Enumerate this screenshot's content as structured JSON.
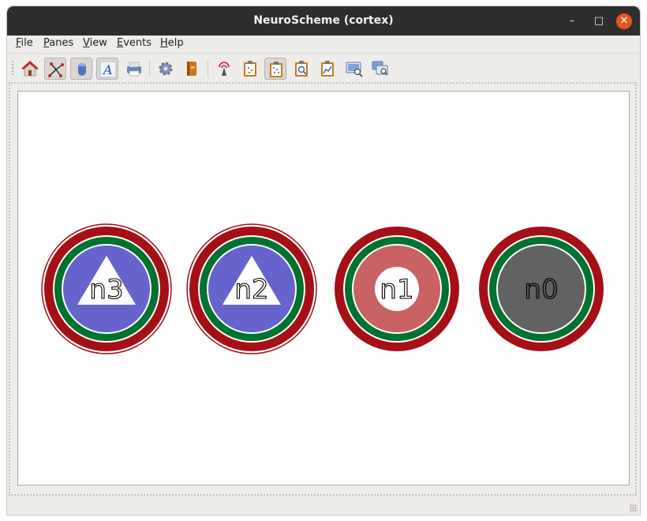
{
  "window": {
    "title": "NeuroScheme (cortex)"
  },
  "menubar": [
    {
      "prefix": "",
      "accel": "F",
      "rest": "ile"
    },
    {
      "prefix": "",
      "accel": "P",
      "rest": "anes"
    },
    {
      "prefix": "",
      "accel": "V",
      "rest": "iew"
    },
    {
      "prefix": "",
      "accel": "E",
      "rest": "vents"
    },
    {
      "prefix": "",
      "accel": "H",
      "rest": "elp"
    }
  ],
  "toolbar": {
    "buttons": [
      {
        "icon": "home-icon"
      },
      {
        "icon": "scatter-selection-icon",
        "pressed": true
      },
      {
        "icon": "cylinder-shape-icon",
        "pressed": true
      },
      {
        "icon": "text-font-icon",
        "pressed": true
      },
      {
        "icon": "printer-icon"
      },
      {
        "icon": "gear-icon"
      },
      {
        "icon": "book-icon"
      },
      {
        "icon": "broadcast-icon"
      },
      {
        "icon": "clipboard-icon"
      },
      {
        "icon": "clipboard-dots-icon",
        "pressed": true
      },
      {
        "icon": "clipboard-search-icon"
      },
      {
        "icon": "clipboard-chart-icon"
      },
      {
        "icon": "screen-zoom-icon"
      },
      {
        "icon": "screen-compare-icon"
      }
    ]
  },
  "canvas": {
    "nodes": [
      {
        "label": "n3",
        "shape": "triangle",
        "inner_color": "#6664cc",
        "outer_ring": "#a60f16",
        "mid_ring": "#00722f",
        "thin_outline": true
      },
      {
        "label": "n2",
        "shape": "triangle",
        "inner_color": "#6664cc",
        "outer_ring": "#a60f16",
        "mid_ring": "#00722f",
        "thin_outline": true
      },
      {
        "label": "n1",
        "shape": "hollow-circle",
        "inner_color": "#c96262",
        "outer_ring": "#a60f16",
        "mid_ring": "#00722f",
        "thin_outline": false
      },
      {
        "label": "n0",
        "shape": "filled-circle",
        "inner_color": "#626262",
        "outer_ring": "#a60f16",
        "mid_ring": "#00722f",
        "thin_outline": false
      }
    ]
  }
}
